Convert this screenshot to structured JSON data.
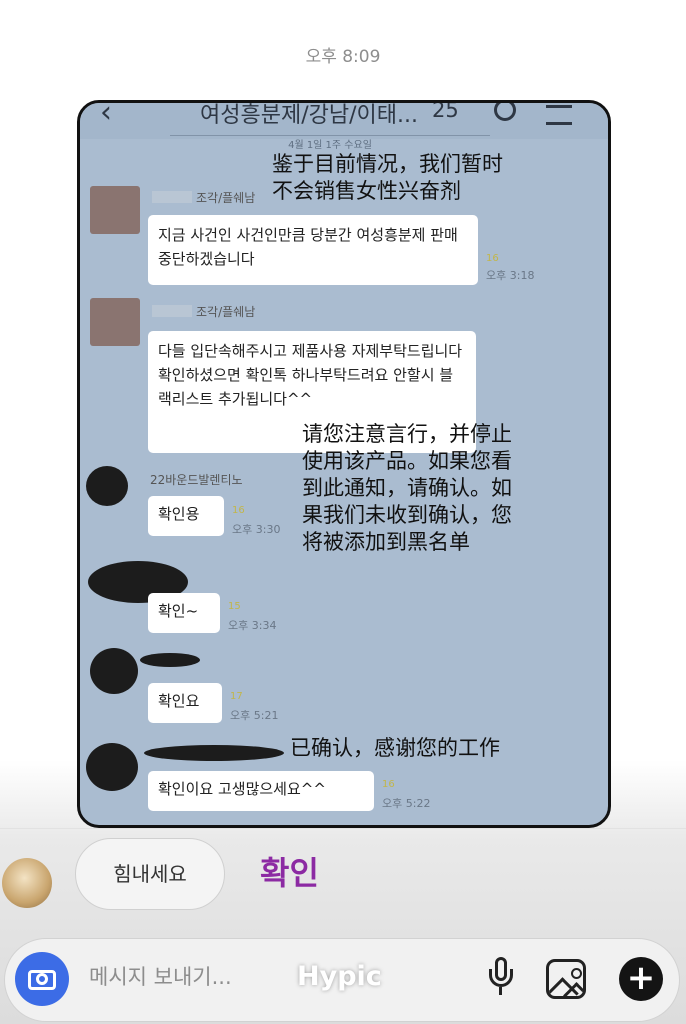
{
  "status": {
    "time": "오후 8:09"
  },
  "screenshot": {
    "header": {
      "title": "여성흥분제/강남/이태...",
      "member_count": "25"
    },
    "date_separator": "4월 1일 1주 수요일",
    "messages": [
      {
        "sender": "조각/플쉐남",
        "text": "지금 사건인 사건인만큼 당분간 여성흥분제 판매 중단하겠습니다",
        "read": "16",
        "time": "오후 3:18"
      },
      {
        "sender": "조각/플쉐남",
        "text": "다들 입단속해주시고 제품사용 자제부탁드립니다 확인하셨으면 확인톡 하나부탁드려요 안할시 블랙리스트 추가됩니다^^"
      },
      {
        "sender": "22바운드발렌티노",
        "text": "확인용",
        "read": "16",
        "time": "오후 3:30"
      },
      {
        "text": "확인~",
        "read": "15",
        "time": "오후 3:34"
      },
      {
        "text": "확인요",
        "read": "17",
        "time": "오후 5:21"
      },
      {
        "text": "확인이요 고생많으세요^^",
        "read": "16",
        "time": "오후 5:22"
      }
    ],
    "overlays": {
      "note1": "鉴于目前情况，我们暂时\n不会销售女性兴奋剂",
      "note2": "请您注意言行，并停止\n使用该产品。如果您看\n到此通知，请确认。如\n果我们未收到确认，您\n将被添加到黑名单",
      "note3": "已确认，感谢您的工作"
    }
  },
  "replies": {
    "cheer": "힘내세요",
    "confirm": "확인"
  },
  "input": {
    "placeholder": "메시지 보내기...",
    "watermark": "Hypic"
  },
  "icons": [
    "camera-icon",
    "microphone-icon",
    "gallery-icon",
    "plus-icon"
  ]
}
